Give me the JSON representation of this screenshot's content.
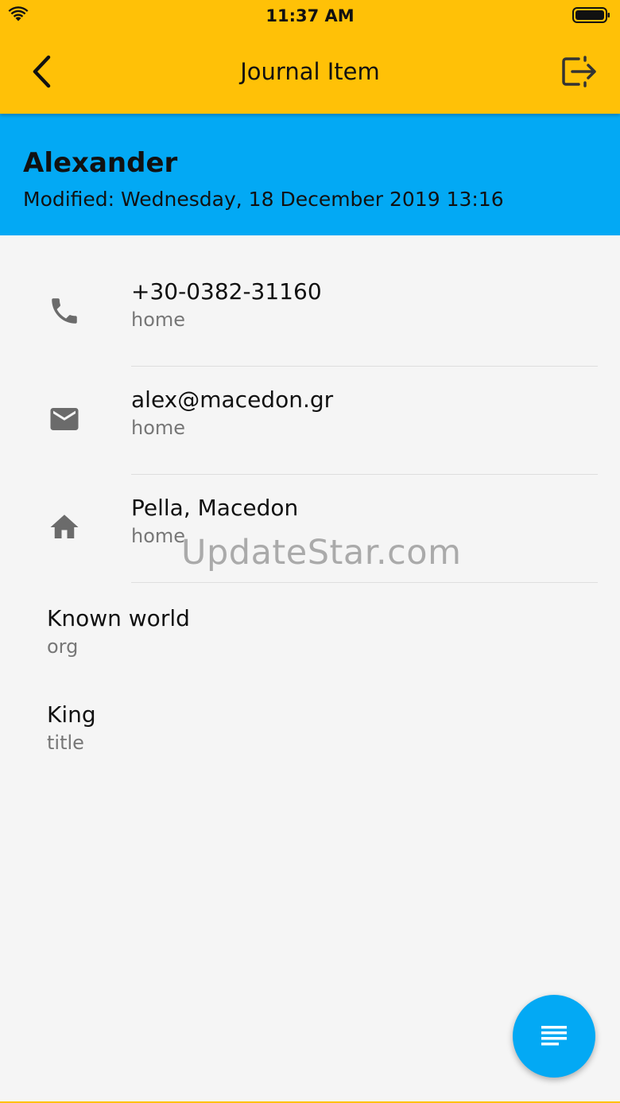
{
  "status_bar": {
    "time": "11:37 AM",
    "icons": [
      "wifi-icon",
      "battery-icon"
    ]
  },
  "app_bar": {
    "title": "Journal Item",
    "back_icon": "chevron-left-icon",
    "action_icon": "exit-to-app-icon"
  },
  "header": {
    "name": "Alexander",
    "modified": "Modified: Wednesday, 18 December 2019 13:16"
  },
  "details": [
    {
      "icon": "phone-icon",
      "value": "+30-0382-31160",
      "type": "home"
    },
    {
      "icon": "email-icon",
      "value": "alex@macedon.gr",
      "type": "home"
    },
    {
      "icon": "home-icon",
      "value": "Pella, Macedon",
      "type": "home"
    }
  ],
  "plain_fields": [
    {
      "value": "Known world",
      "label": "org"
    },
    {
      "value": "King",
      "label": "title"
    }
  ],
  "watermark": "UpdateStar.com",
  "fab": {
    "icon": "notes-icon"
  },
  "colors": {
    "app_bar": "#ffc107",
    "header": "#03a9f4",
    "fab": "#03a9f4",
    "background": "#f5f5f5"
  }
}
